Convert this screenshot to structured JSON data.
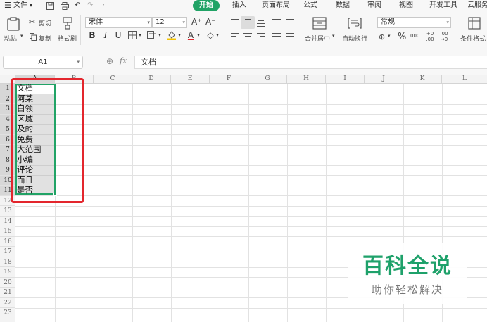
{
  "menubar": {
    "file": "文件",
    "tabs": [
      "开始",
      "插入",
      "页面布局",
      "公式",
      "数据",
      "审阅",
      "视图",
      "开发工具",
      "云服务"
    ]
  },
  "ribbon": {
    "paste": "粘贴",
    "cut": "剪切",
    "copy": "复制",
    "format_painter": "格式刷",
    "font_name": "宋体",
    "font_size": "12",
    "grow_font": "A⁺",
    "shrink_font": "A⁻",
    "bold": "B",
    "italic": "I",
    "underline": "U",
    "merge_center": "合并居中",
    "wrap_text": "自动换行",
    "number_format": "常规",
    "percent": "%",
    "thousands": "000",
    "inc_decimal": "+0 .00",
    "dec_decimal": ".00 →0",
    "conditional_format": "条件格式"
  },
  "formula_bar": {
    "name_box": "A1",
    "fx": "fx",
    "content": "文档"
  },
  "sheet": {
    "columns": [
      "A",
      "B",
      "C",
      "D",
      "E",
      "F",
      "G",
      "H",
      "I",
      "J",
      "K",
      "L"
    ],
    "rows": [
      "1",
      "2",
      "3",
      "4",
      "5",
      "6",
      "7",
      "8",
      "9",
      "10",
      "11",
      "12",
      "13",
      "14",
      "15",
      "16",
      "17",
      "18",
      "19",
      "20",
      "21",
      "22",
      "23"
    ],
    "column_a_values": [
      "文档",
      "阿某",
      "白领",
      "区域",
      "及的",
      "免费",
      "大范围",
      "小编",
      "评论",
      "而且",
      "是否"
    ]
  },
  "watermark": {
    "title": "百科全说",
    "subtitle": "助你轻松解决"
  },
  "colors": {
    "accent": "#21a366",
    "highlight_box": "#e3262d"
  }
}
